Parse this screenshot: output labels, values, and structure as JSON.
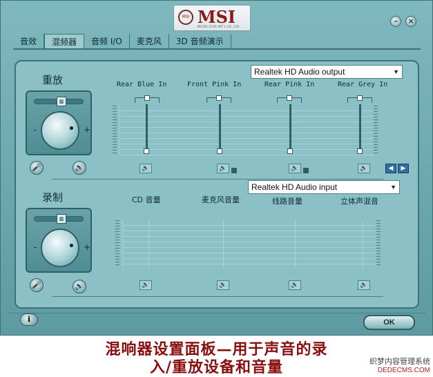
{
  "window": {
    "brand": "MSI",
    "brand_sub": "MICRO-STAR INT'L CO.,LTD.",
    "badge": "MSI",
    "minimize": "–",
    "close": "×"
  },
  "tabs": [
    "音效",
    "混频器",
    "音频 I/O",
    "麦克风",
    "3D 音频演示"
  ],
  "active_tab": 1,
  "playback": {
    "title": "重放",
    "device": "Realtek HD Audio output",
    "channels": [
      "Rear Blue In",
      "Front Pink In",
      "Rear Pink In",
      "Rear Grey In"
    ],
    "levels": [
      1.0,
      1.0,
      1.0,
      1.0
    ]
  },
  "record": {
    "title": "录制",
    "device": "Realtek HD Audio input",
    "channels": [
      "CD 音量",
      "麦克风音量",
      "线路音量",
      "立体声混音"
    ]
  },
  "knob": {
    "minus": "-",
    "plus": "+",
    "thumb": "▥"
  },
  "mute_icon": "🔈",
  "speaker_icon": "🔊",
  "mic_icon": "🎤",
  "scroll": {
    "left": "◀",
    "right": "▶"
  },
  "ok_label": "OK",
  "info_label": "i",
  "caption": {
    "line1": "混响器设置面板—用于声音的录",
    "line2": "入/重放设备和音量"
  },
  "watermark": {
    "line1": "织梦内容管理系统",
    "line2": "DEDECMS.COM"
  }
}
